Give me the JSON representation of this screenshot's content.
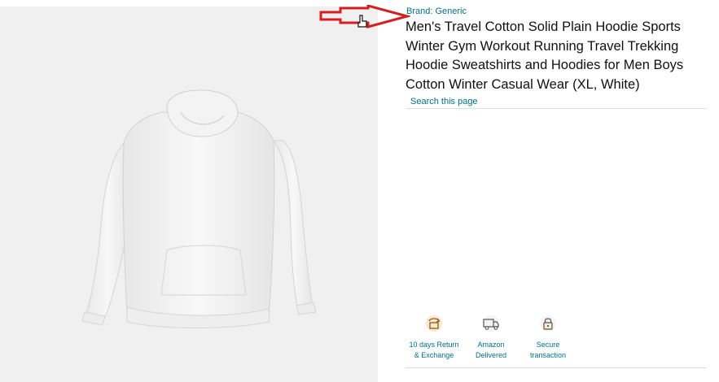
{
  "product": {
    "brand_label": "Brand: Generic",
    "title": "Men's Travel Cotton Solid Plain Hoodie Sports Winter Gym Workout Running Travel Trekking Hoodie Sweatshirts and Hoodies for Men Boys Cotton Winter Casual Wear (XL, White)",
    "search_link": "Search this page",
    "image_alt_icon": "white-hoodie-product-image"
  },
  "features": [
    {
      "icon": "return-box-icon",
      "label": "10 days Return\n& Exchange"
    },
    {
      "icon": "delivery-truck-icon",
      "label": "Amazon\nDelivered"
    },
    {
      "icon": "secure-lock-icon",
      "label": "Secure\ntransaction"
    }
  ],
  "annotation": {
    "arrow_color": "#d42020"
  },
  "colors": {
    "link": "#007185",
    "text": "#0f1111",
    "icon_orange": "#e39a3b"
  }
}
